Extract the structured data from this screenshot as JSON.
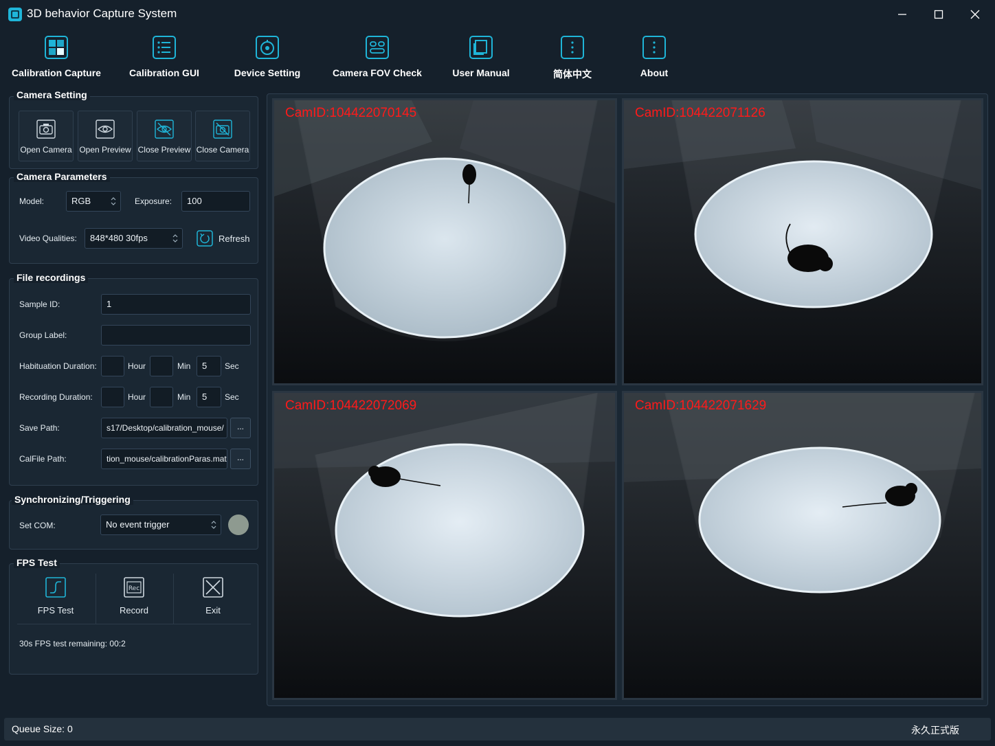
{
  "window": {
    "title": "3D behavior Capture System"
  },
  "toolbar": {
    "items": [
      {
        "label": "Calibration Capture",
        "icon": "calibration-capture-icon"
      },
      {
        "label": "Calibration GUI",
        "icon": "list-icon"
      },
      {
        "label": "Device Setting",
        "icon": "device-icon"
      },
      {
        "label": "Camera FOV Check",
        "icon": "fov-icon"
      },
      {
        "label": "User Manual",
        "icon": "manual-icon"
      },
      {
        "label": "简体中文",
        "icon": "more-vertical-icon"
      },
      {
        "label": "About",
        "icon": "more-vertical-icon"
      }
    ]
  },
  "camera_setting": {
    "title": "Camera Setting",
    "buttons": [
      {
        "label": "Open Camera",
        "icon": "camera-icon"
      },
      {
        "label": "Open Preview",
        "icon": "eye-icon"
      },
      {
        "label": "Close Preview",
        "icon": "eye-off-icon"
      },
      {
        "label": "Close Camera",
        "icon": "camera-off-icon"
      }
    ]
  },
  "camera_parameters": {
    "title": "Camera Parameters",
    "model_label": "Model:",
    "model_value": "RGB",
    "exposure_label": "Exposure:",
    "exposure_value": "100",
    "video_label": "Video Qualities:",
    "video_value": "848*480 30fps",
    "refresh_label": "Refresh"
  },
  "file_recordings": {
    "title": "File recordings",
    "sample_id_label": "Sample ID:",
    "sample_id_value": "1",
    "group_label_label": "Group Label:",
    "group_label_value": "",
    "habituation_label": "Habituation Duration:",
    "habituation": {
      "hour": "",
      "min": "",
      "sec": "5"
    },
    "recording_label": "Recording Duration:",
    "recording": {
      "hour": "",
      "min": "",
      "sec": "5"
    },
    "unit_hour": "Hour",
    "unit_min": "Min",
    "unit_sec": "Sec",
    "save_path_label": "Save Path:",
    "save_path_value": "s17/Desktop/calibration_mouse/",
    "calfile_label": "CalFile Path:",
    "calfile_value": "tion_mouse/calibrationParas.mat",
    "browse_label": "..."
  },
  "sync": {
    "title": "Synchronizing/Triggering",
    "com_label": "Set COM:",
    "com_value": "No event trigger",
    "indicator_color": "#8e9a90"
  },
  "fps_test": {
    "title": "FPS Test",
    "buttons": [
      {
        "label": "FPS Test",
        "icon": "fps-test-icon"
      },
      {
        "label": "Record",
        "icon": "rec-icon"
      },
      {
        "label": "Exit",
        "icon": "exit-icon"
      }
    ],
    "status": "30s FPS test remaining: 00:2"
  },
  "cameras": [
    {
      "id": "CamID:104422070145"
    },
    {
      "id": "CamID:104422071126"
    },
    {
      "id": "CamID:104422072069"
    },
    {
      "id": "CamID:104422071629"
    }
  ],
  "statusbar": {
    "left": "Queue Size: 0",
    "right": "永久正式版"
  },
  "colors": {
    "accent": "#1fb5d8",
    "background": "#15202b",
    "camid_text": "#ff1a1a"
  }
}
